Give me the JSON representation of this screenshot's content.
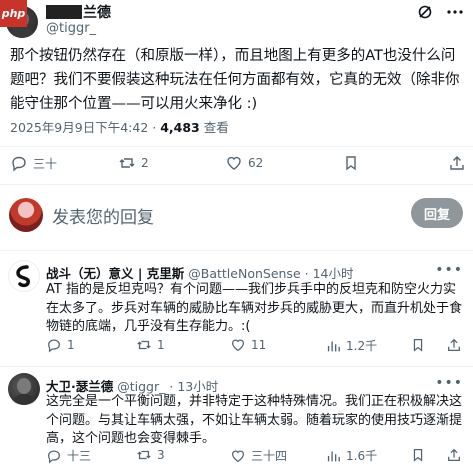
{
  "header": {
    "site_badge": "php",
    "author_name": "兰德",
    "author_handle": "@tiggr_"
  },
  "post": {
    "text": "那个按钮仍然存在（和原版一样），而且地图上有更多的AT也没什么问题吧？我们不要假装这种玩法在任何方面都有效，它真的无效（除非你能守住那个位置——可以用火来净化 :)",
    "date": "2025年9月9日下午4:42 · ",
    "views_count": "4,483",
    "views_label": "查看",
    "actions": {
      "reply": "三十",
      "retweet": "2",
      "like": "62"
    }
  },
  "reply_box": {
    "placeholder": "发表您的回复",
    "button": "回复"
  },
  "comments": [
    {
      "name": "战斗（无）意义 | 克里斯",
      "handle": "@BattleNonSense",
      "time": "14小时",
      "text": "AT 指的是反坦克吗？有个问题——我们步兵手中的反坦克和防空火力实在太多了。步兵对车辆的威胁比车辆对步兵的威胁更大，而直升机处于食物链的底端，几乎没有生存能力。:(",
      "reply": "1",
      "retweet": "1",
      "like": "11",
      "views": "1.2千"
    },
    {
      "name": "大卫·瑟兰德",
      "handle": "@tiggr_",
      "time": "13小时",
      "text": "这完全是一个平衡问题，并非特定于这种特殊情况。我们正在积极解决这个问题。与其让车辆太强，不如让车辆太弱。随着玩家的使用技巧逐渐提高，这个问题也会变得棘手。",
      "reply": "十三",
      "retweet": "3",
      "like": "三十四",
      "views": "1.6千"
    }
  ],
  "colors": {
    "text": "#0f1419",
    "muted": "#536471",
    "divider": "#eff3f4",
    "reply_button": "#8f979d",
    "badge": "#c8332a"
  },
  "icons": [
    "grok-icon",
    "more-icon",
    "reply-icon",
    "retweet-icon",
    "like-icon",
    "views-icon",
    "bookmark-icon",
    "share-icon"
  ]
}
